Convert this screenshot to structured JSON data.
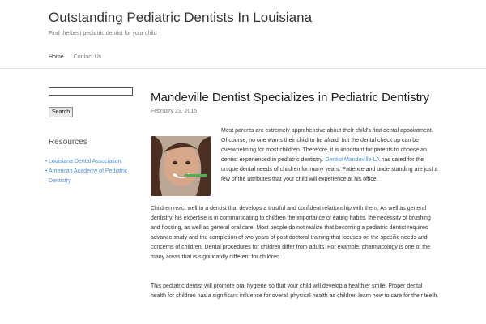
{
  "site": {
    "title": "Outstanding Pediatric Dentists In Louisiana",
    "description": "Find the best pediatric dentist for your child"
  },
  "nav": {
    "items": [
      {
        "label": "Home",
        "active": true
      },
      {
        "label": "Contact Us",
        "active": false
      }
    ]
  },
  "sidebar": {
    "search": {
      "value": "",
      "button_label": "Search"
    },
    "widget_title": "Resources",
    "links": [
      {
        "label": "Louisiana Dental Association"
      },
      {
        "label": "American Academy of Pediatric Dentistry"
      }
    ]
  },
  "post": {
    "title": "Mandeville Dentist Specializes in Pediatric Dentistry",
    "date": "February 23, 2015",
    "p1_before": "Most parents are extremely apprehensive about their child's first dental appointment. Of course, no one wants their child to be afraid, but the dental check up can be overwhelming for most children. Therefore, it is important for parents to choose an dentist experienced in pediatric dentistry. ",
    "p1_link": "Dentist Mandeville LA",
    "p1_after": " has cared for the unique dental needs of children for many years. Patience and understanding are just a few of the attributes that your child will experience at his office.",
    "p2": "Children react well to a dentist that develops a trustful and confident relationship with them. As well as general dentistry, his expertise is in communicating to children the importance of eating habits, the necessity of brushing and flossing, as well as general oral care. Most people do not realize that becoming a pediatric dentist requires advance study and the completion of two years of post doctoral training that focuses on the specific needs and concerns of children. Dental procedures for children differ from adults. For example, pharmacology is one of the many areas that is significantly different for children.",
    "p3": "This pediatric dentist will promote oral hygiene so that your child will develop a healthier smile. Proper dental health for children has a significant influence for overall physical health as children learn how to care for their teeth.",
    "p4": ""
  },
  "colors": {
    "link": "#4a90e2",
    "text": "#333333",
    "muted": "#777777"
  }
}
